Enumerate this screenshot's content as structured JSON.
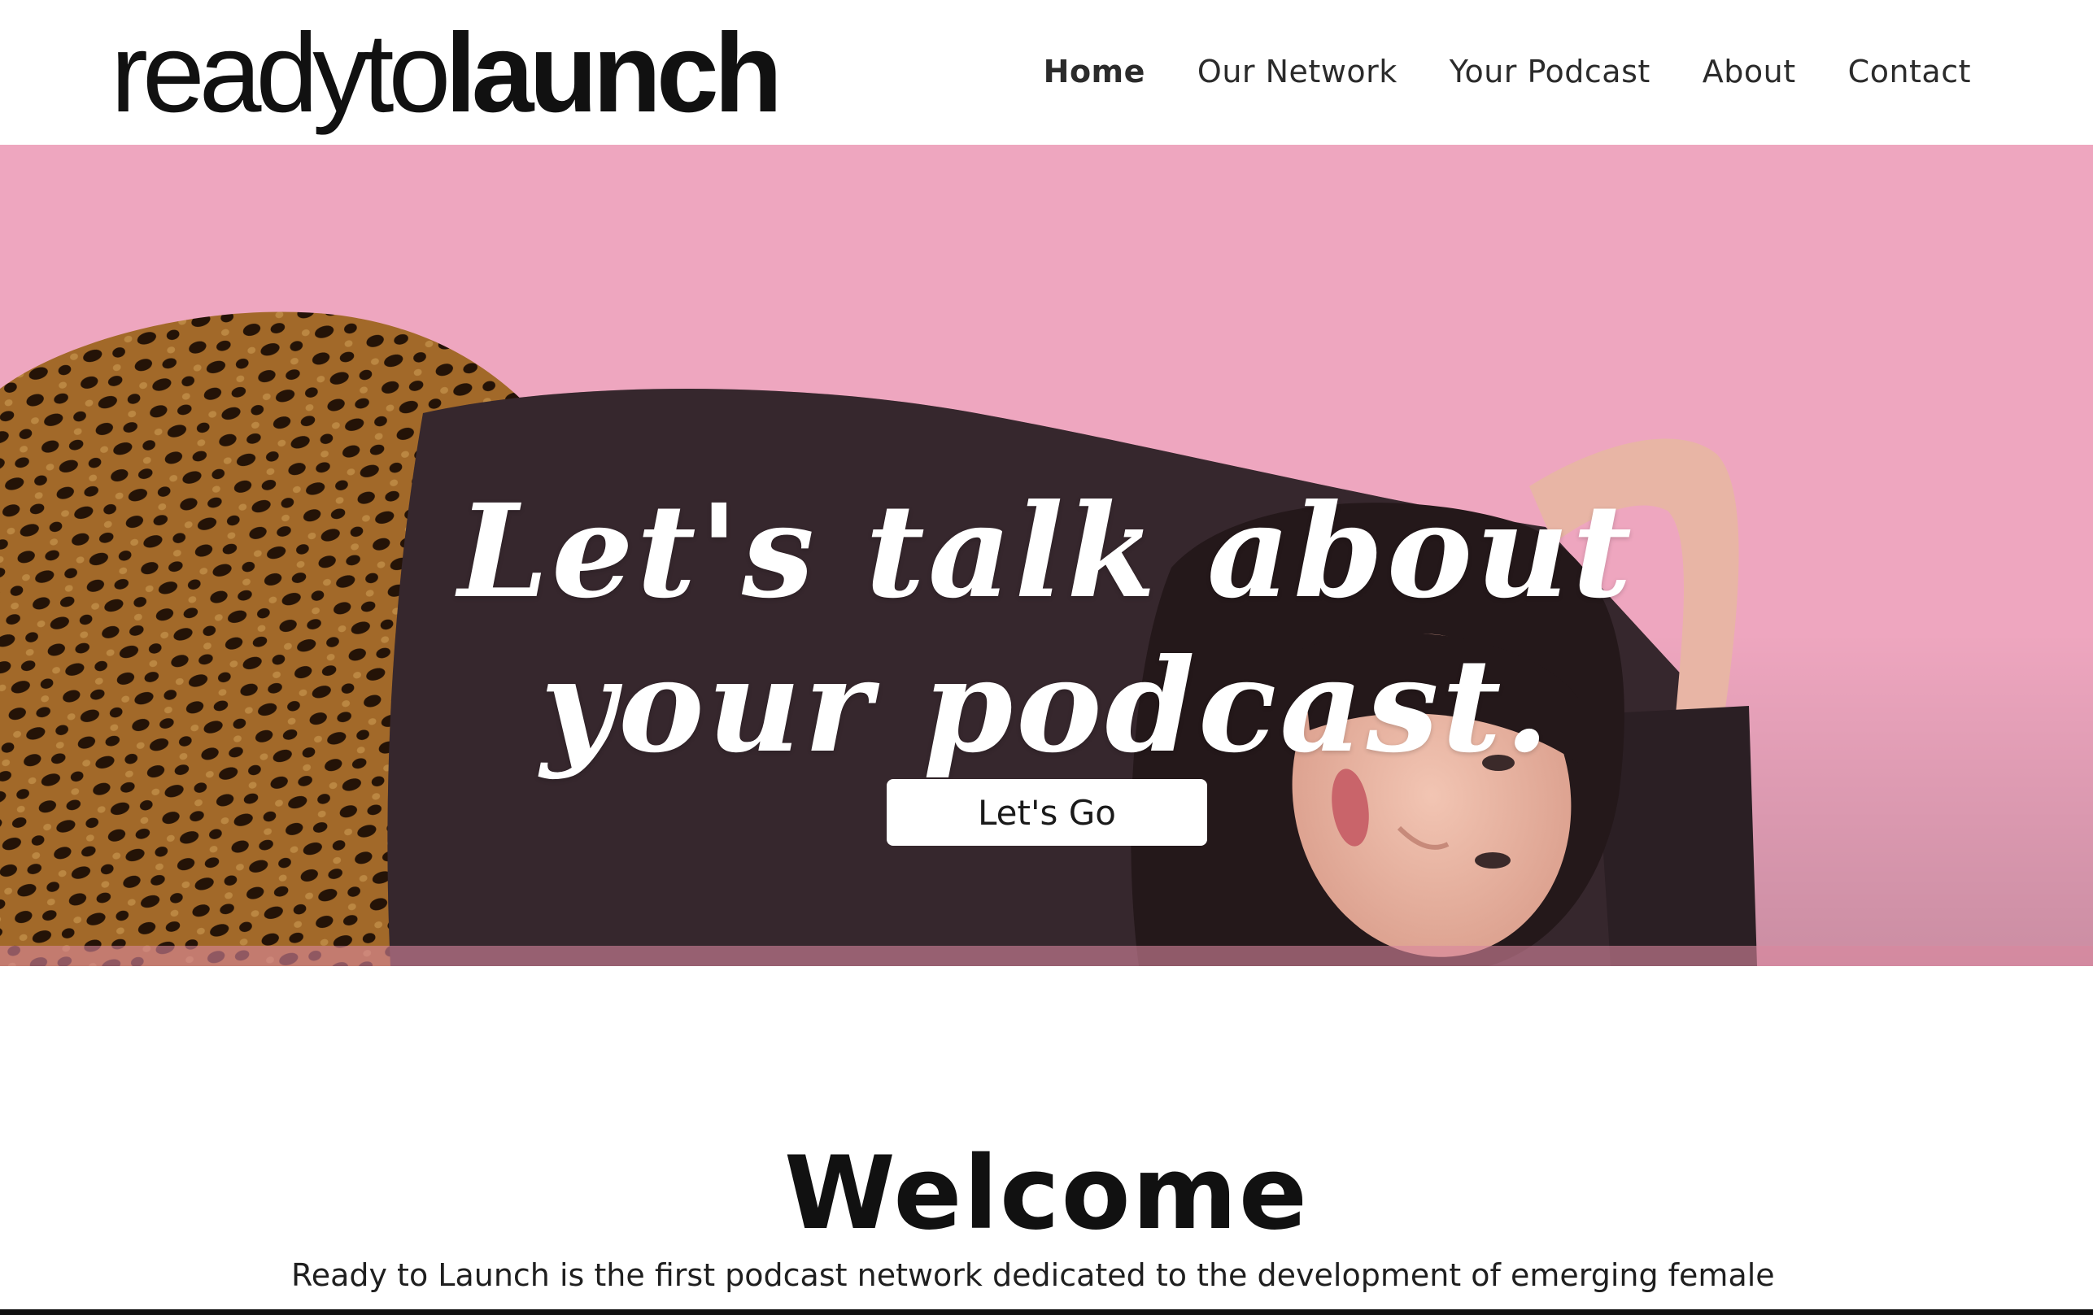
{
  "brand": {
    "logo_light": "readyto",
    "logo_bold": "launch"
  },
  "nav": {
    "items": [
      {
        "label": "Home",
        "active": true
      },
      {
        "label": "Our Network",
        "active": false
      },
      {
        "label": "Your Podcast",
        "active": false
      },
      {
        "label": "About",
        "active": false
      },
      {
        "label": "Contact",
        "active": false
      }
    ]
  },
  "hero": {
    "headline_line1": "Let's talk about",
    "headline_line2": "your podcast.",
    "cta_label": "Let's Go",
    "background_color": "#ec9fba"
  },
  "welcome": {
    "title": "Welcome",
    "body": "Ready to Launch is the first podcast network dedicated to the development of emerging female voices. We connect and support ambitious female podcasters so that they may successfully"
  }
}
